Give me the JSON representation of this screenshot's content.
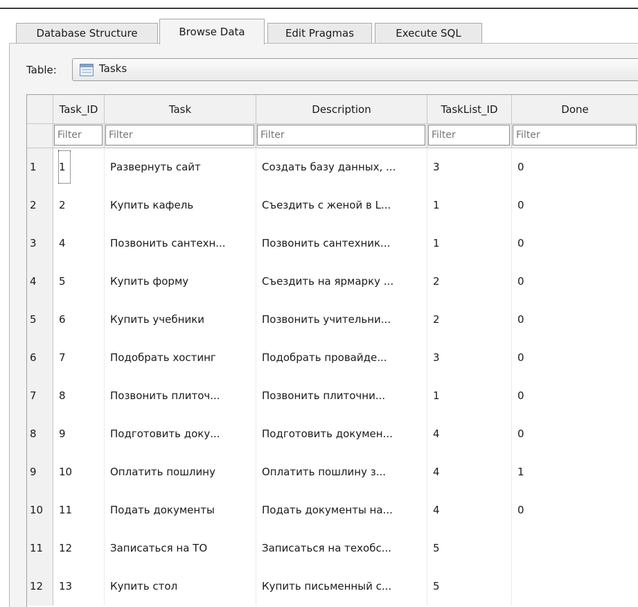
{
  "tabs": [
    {
      "label": "Database Structure",
      "active": false
    },
    {
      "label": "Browse Data",
      "active": true
    },
    {
      "label": "Edit Pragmas",
      "active": false
    },
    {
      "label": "Execute SQL",
      "active": false
    }
  ],
  "table_selector": {
    "label": "Table:",
    "value": "Tasks",
    "icon": "table-icon"
  },
  "grid": {
    "columns": [
      "Task_ID",
      "Task",
      "Description",
      "TaskList_ID",
      "Done"
    ],
    "filter_placeholder": "Filter",
    "rows": [
      {
        "num": "1",
        "cells": [
          "1",
          "Развернуть сайт",
          "Создать базу данных, ...",
          "3",
          "0"
        ]
      },
      {
        "num": "2",
        "cells": [
          "2",
          "Купить кафель",
          "Съездить с женой в L...",
          "1",
          "0"
        ]
      },
      {
        "num": "3",
        "cells": [
          "4",
          "Позвонить сантехн...",
          "Позвонить сантехник...",
          "1",
          "0"
        ]
      },
      {
        "num": "4",
        "cells": [
          "5",
          "Купить форму",
          "Съездить на ярмарку ...",
          "2",
          "0"
        ]
      },
      {
        "num": "5",
        "cells": [
          "6",
          "Купить учебники",
          "Позвонить учительни...",
          "2",
          "0"
        ]
      },
      {
        "num": "6",
        "cells": [
          "7",
          "Подобрать хостинг",
          "Подобрать провайде...",
          "3",
          "0"
        ]
      },
      {
        "num": "7",
        "cells": [
          "8",
          "Позвонить плиточ...",
          "Позвонить плиточни...",
          "1",
          "0"
        ]
      },
      {
        "num": "8",
        "cells": [
          "9",
          "Подготовить доку...",
          "Подготовить докумен...",
          "4",
          "0"
        ]
      },
      {
        "num": "9",
        "cells": [
          "10",
          "Оплатить пошлину",
          "Оплатить пошлину з...",
          "4",
          "1"
        ]
      },
      {
        "num": "10",
        "cells": [
          "11",
          "Подать документы",
          "Подать документы на...",
          "4",
          "0"
        ]
      },
      {
        "num": "11",
        "cells": [
          "12",
          "Записаться на ТО",
          "Записаться на техобс...",
          "5",
          ""
        ]
      },
      {
        "num": "12",
        "cells": [
          "13",
          "Купить стол",
          "Купить письменный с...",
          "5",
          ""
        ]
      }
    ]
  }
}
